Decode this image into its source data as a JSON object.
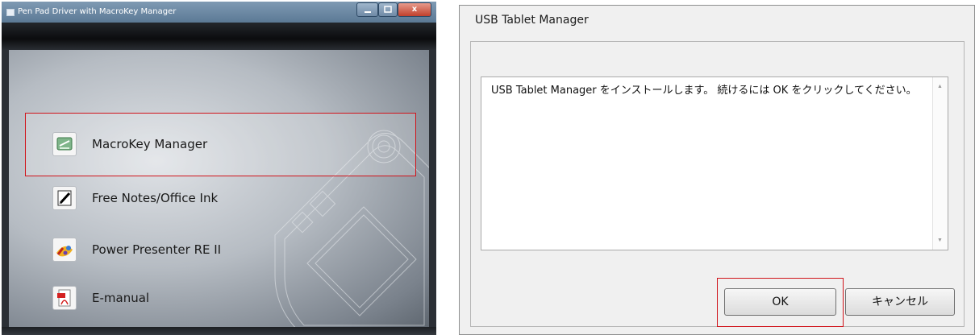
{
  "left_window": {
    "title": "Pen Pad Driver with MacroKey Manager",
    "controls": {
      "close": "x"
    },
    "menu_items": [
      {
        "label": "MacroKey Manager",
        "icon": "macrokey-icon",
        "selected": true
      },
      {
        "label": "Free Notes/Office Ink",
        "icon": "pen-note-icon",
        "selected": false
      },
      {
        "label": "Power Presenter RE II",
        "icon": "presenter-icon",
        "selected": false
      },
      {
        "label": "E-manual",
        "icon": "pdf-icon",
        "selected": false
      }
    ]
  },
  "right_dialog": {
    "title": "USB Tablet Manager",
    "message": "USB Tablet Manager をインストールします。 続けるには OK をクリックしてください。",
    "buttons": {
      "ok": "OK",
      "cancel": "キャンセル"
    }
  },
  "colors": {
    "highlight": "#d0141b",
    "titlebar": "#6f8aa6"
  }
}
